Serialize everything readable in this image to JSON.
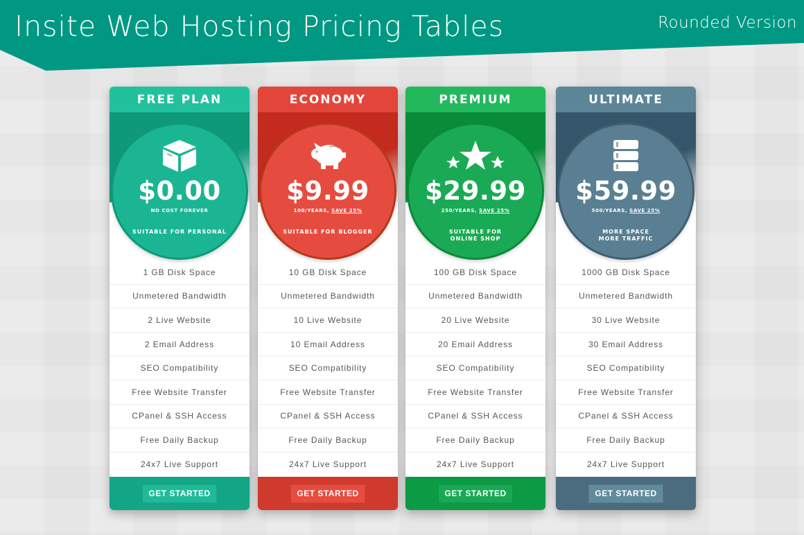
{
  "banner": {
    "title": "Insite Web Hosting Pricing Tables",
    "subtitle": "Rounded Version",
    "color": "#009882"
  },
  "plans": [
    {
      "name": "FREE PLAN",
      "icon": "box-icon",
      "price": "$0.00",
      "note": "NO COST FOREVER",
      "save": "",
      "suitable": "SUITABLE FOR PERSONAL",
      "header_color": "#22c19e",
      "band_color": "#0e9a78",
      "circle_color": "#1bb594",
      "circle_border": "#0f9a7a",
      "footer_color": "#12a686",
      "button_color": "#1fbb99",
      "features": [
        "1 GB Disk Space",
        "Unmetered Bandwidth",
        "2 Live Website",
        "2 Email Address",
        "SEO Compatibility",
        "Free Website Transfer",
        "CPanel & SSH Access",
        "Free Daily Backup",
        "24x7 Live Support"
      ],
      "button": "GET STARTED"
    },
    {
      "name": "ECONOMY",
      "icon": "piggy-bank-icon",
      "price": "$9.99",
      "note": "100/YEARS,",
      "save": "SAVE 25%",
      "suitable": "SUITABLE FOR BLOGGER",
      "header_color": "#e2463a",
      "band_color": "#c42a1d",
      "circle_color": "#e54c3f",
      "circle_border": "#b8371a",
      "footer_color": "#d03a2c",
      "button_color": "#e74c3f",
      "features": [
        "10 GB Disk Space",
        "Unmetered Bandwidth",
        "10 Live Website",
        "10 Email Address",
        "SEO Compatibility",
        "Free Website Transfer",
        "CPanel & SSH Access",
        "Free Daily Backup",
        "24x7 Live Support"
      ],
      "button": "GET STARTED"
    },
    {
      "name": "PREMIUM",
      "icon": "stars-icon",
      "price": "$29.99",
      "note": "250/YEARS,",
      "save": "SAVE 25%",
      "suitable": "SUITABLE FOR\nONLINE SHOP",
      "header_color": "#22b95d",
      "band_color": "#098c38",
      "circle_color": "#1aaa55",
      "circle_border": "#0b8a3c",
      "footer_color": "#0d9a44",
      "button_color": "#18a954",
      "features": [
        "100 GB Disk Space",
        "Unmetered Bandwidth",
        "20 Live Website",
        "20 Email Address",
        "SEO Compatibility",
        "Free Website Transfer",
        "CPanel & SSH Access",
        "Free Daily Backup",
        "24x7 Live Support"
      ],
      "button": "GET STARTED"
    },
    {
      "name": "ULTIMATE",
      "icon": "server-icon",
      "price": "$59.99",
      "note": "500/YEARS,",
      "save": "SAVE 25%",
      "suitable": "MORE SPACE\nMORE TRAFFIC",
      "header_color": "#5c8598",
      "band_color": "#35566a",
      "circle_color": "#5a7f92",
      "circle_border": "#3f5e70",
      "footer_color": "#4b6c7e",
      "button_color": "#628a9d",
      "features": [
        "1000 GB Disk Space",
        "Unmetered Bandwidth",
        "30 Live Website",
        "30 Email Address",
        "SEO Compatibility",
        "Free Website Transfer",
        "CPanel & SSH Access",
        "Free Daily Backup",
        "24x7 Live Support"
      ],
      "button": "GET STARTED"
    }
  ]
}
